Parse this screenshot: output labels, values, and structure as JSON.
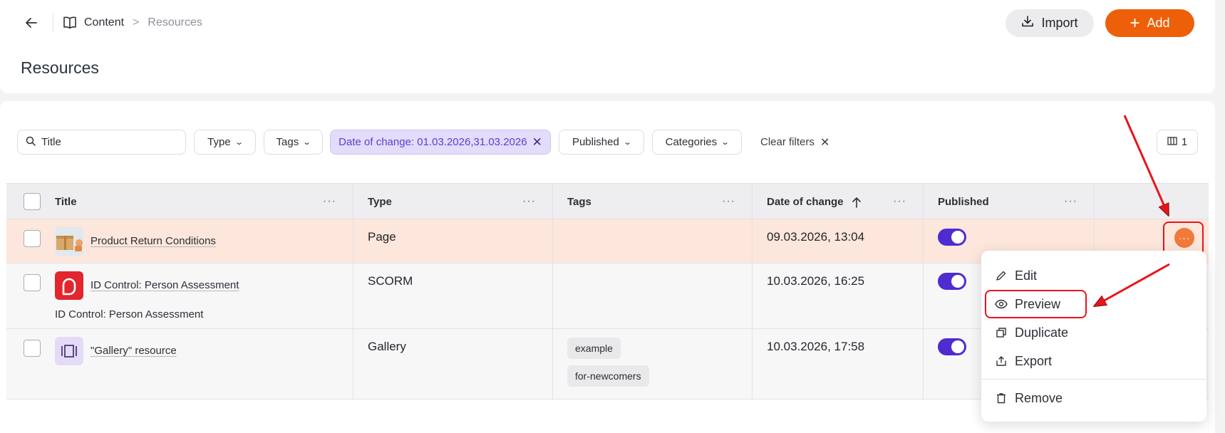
{
  "header": {
    "breadcrumb": {
      "content": "Content",
      "separator": ">",
      "current": "Resources"
    },
    "page_title": "Resources",
    "import_label": "Import",
    "add_label": "Add"
  },
  "filters": {
    "search_placeholder": "Title",
    "type": "Type",
    "tags": "Tags",
    "date_filter": "Date of change: 01.03.2026,31.03.2026",
    "published": "Published",
    "categories": "Categories",
    "clear": "Clear filters",
    "columns_count": "1"
  },
  "table": {
    "columns": [
      "Title",
      "Type",
      "Tags",
      "Date of change",
      "Published"
    ],
    "rows": [
      {
        "title": "Product Return Conditions",
        "subtitle": "",
        "type": "Page",
        "tags": [],
        "date": "09.03.2026, 13:04",
        "published": true,
        "highlighted": true
      },
      {
        "title": "ID Control: Person Assessment",
        "subtitle": "ID Control: Person Assessment",
        "type": "SCORM",
        "tags": [],
        "date": "10.03.2026, 16:25",
        "published": true,
        "highlighted": false
      },
      {
        "title": "\"Gallery\" resource",
        "subtitle": "",
        "type": "Gallery",
        "tags": [
          "example",
          "for-newcomers"
        ],
        "date": "10.03.2026, 17:58",
        "published": true,
        "highlighted": false
      }
    ]
  },
  "row_menu": {
    "items": [
      "Edit",
      "Preview",
      "Duplicate",
      "Export",
      "Remove"
    ]
  },
  "colors": {
    "accent": "#ee5f0a",
    "toggle": "#4f2bd0",
    "active_filter_bg": "#e3dcfb",
    "annotation": "#e8141c",
    "row_highlight": "#fde6db"
  },
  "icons": {
    "back": "arrow-left-icon",
    "breadcrumb": "book-icon",
    "import": "download-icon",
    "add": "plus-icon",
    "search": "search-icon",
    "clear": "close-icon",
    "columns": "columns-icon",
    "sort": "arrow-up-icon",
    "menu": [
      "pencil-icon",
      "eye-icon",
      "copy-icon",
      "export-icon",
      "trash-icon"
    ]
  }
}
